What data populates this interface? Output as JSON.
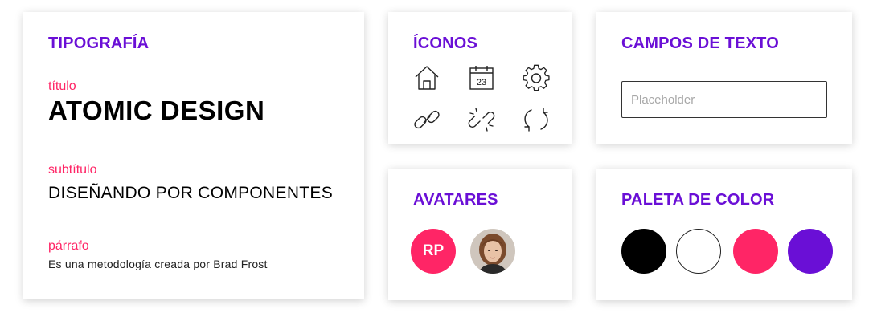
{
  "typography": {
    "title": "TIPOGRAFÍA",
    "title_label": "título",
    "title_value": "ATOMIC DESIGN",
    "subtitle_label": "subtítulo",
    "subtitle_value": "DISEÑANDO POR COMPONENTES",
    "paragraph_label": "párrafo",
    "paragraph_value": "Es una metodología creada por Brad Frost"
  },
  "icons": {
    "title": "ÍCONOS",
    "items": [
      "home-icon",
      "calendar-icon",
      "gear-icon",
      "link-icon",
      "unlink-icon",
      "refresh-icon"
    ],
    "calendar_day": "23"
  },
  "text_fields": {
    "title": "CAMPOS DE TEXTO",
    "placeholder": "Placeholder"
  },
  "avatars": {
    "title": "AVATARES",
    "initials": "RP",
    "initials_color": "#ff2566"
  },
  "palette": {
    "title": "PALETA DE COLOR",
    "colors": [
      "#000000",
      "#ffffff",
      "#ff2566",
      "#6a0fd6"
    ]
  },
  "colors": {
    "heading": "#6a0fd6",
    "label": "#ff2566"
  }
}
